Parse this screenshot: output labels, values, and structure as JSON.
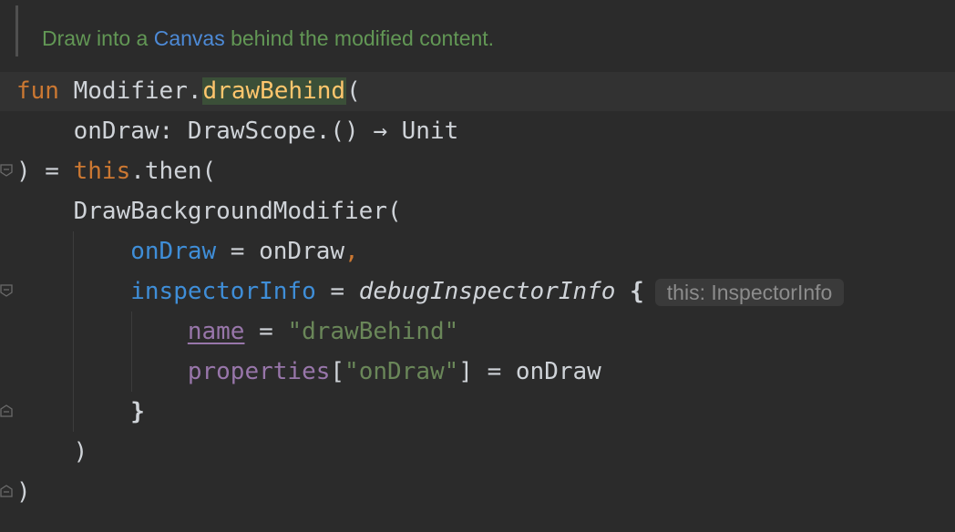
{
  "doc": {
    "prefix": "Draw into a ",
    "link": "Canvas",
    "suffix": " behind the modified content."
  },
  "code": {
    "l1_kw": "fun",
    "l1_recv": " Modifier.",
    "l1_fn": "drawBehind",
    "l1_paren": "(",
    "l2": "    onDraw: DrawScope.() → Unit",
    "l3_close": ") = ",
    "l3_this": "this",
    "l3_rest": ".then(",
    "l4": "    DrawBackgroundModifier(",
    "l5_indent": "        ",
    "l5_param": "onDraw",
    "l5_eq": " = onDraw",
    "l5_comma": ",",
    "l6_indent": "        ",
    "l6_param": "inspectorInfo",
    "l6_eq": " = ",
    "l6_call": "debugInspectorInfo",
    "l6_brace": " {",
    "l6_hint": "this: InspectorInfo",
    "l7_indent": "            ",
    "l7_prop": "name",
    "l7_eq": " = ",
    "l7_str": "\"drawBehind\"",
    "l8_indent": "            ",
    "l8_prop": "properties",
    "l8_open": "[",
    "l8_str": "\"onDraw\"",
    "l8_rest": "] = onDraw",
    "l9": "        }",
    "l10": "    )",
    "l11": ")"
  },
  "colors": {
    "background": "#2b2b2b",
    "keyword": "#cc7832",
    "function": "#ffc66d",
    "named_param": "#3f8ed8",
    "string": "#6a8759",
    "property": "#9876aa",
    "doc_comment": "#629755"
  }
}
